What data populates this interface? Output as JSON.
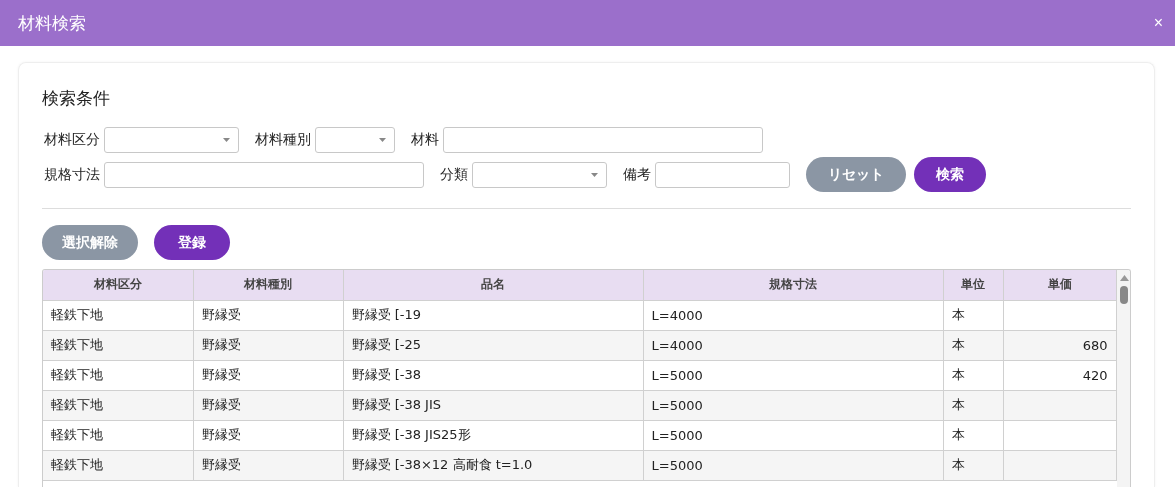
{
  "window": {
    "title": "材料検索",
    "close": "×"
  },
  "search": {
    "heading": "検索条件",
    "rows": [
      [
        {
          "kind": "select",
          "label": "材料区分"
        },
        {
          "kind": "select",
          "label": "材料種別"
        },
        {
          "kind": "text",
          "label": "材料"
        }
      ],
      [
        {
          "kind": "text",
          "label": "規格寸法"
        },
        {
          "kind": "select",
          "label": "分類"
        },
        {
          "kind": "text",
          "label": "備考"
        }
      ]
    ],
    "buttons": [
      {
        "label": "リセット",
        "kind": "secondary"
      },
      {
        "label": "検索",
        "kind": "primary"
      }
    ]
  },
  "actions": [
    {
      "label": "選択解除",
      "kind": "secondary"
    },
    {
      "label": "登録",
      "kind": "primary"
    }
  ],
  "table": {
    "columns": [
      {
        "label": "材料区分"
      },
      {
        "label": "材料種別"
      },
      {
        "label": "品名"
      },
      {
        "label": "規格寸法"
      },
      {
        "label": "単位"
      },
      {
        "label": "単価"
      }
    ],
    "rows": [
      {
        "cells": [
          "軽鉄下地",
          "野縁受",
          "野縁受 [-19",
          "L=4000",
          "本"
        ]
      },
      {
        "cells": [
          "軽鉄下地",
          "野縁受",
          "野縁受 [-25",
          "L=4000",
          "本",
          "680"
        ]
      },
      {
        "cells": [
          "軽鉄下地",
          "野縁受",
          "野縁受 [-38",
          "L=5000",
          "本",
          "420"
        ]
      },
      {
        "cells": [
          "軽鉄下地",
          "野縁受",
          "野縁受 [-38 JIS",
          "L=5000",
          "本"
        ]
      },
      {
        "cells": [
          "軽鉄下地",
          "野縁受",
          "野縁受 [-38 JIS25形",
          "L=5000",
          "本"
        ]
      },
      {
        "cells": [
          "軽鉄下地",
          "野縁受",
          "野縁受 [-38×12 高耐食 t=1.0",
          "L=5000",
          "本"
        ]
      }
    ]
  }
}
